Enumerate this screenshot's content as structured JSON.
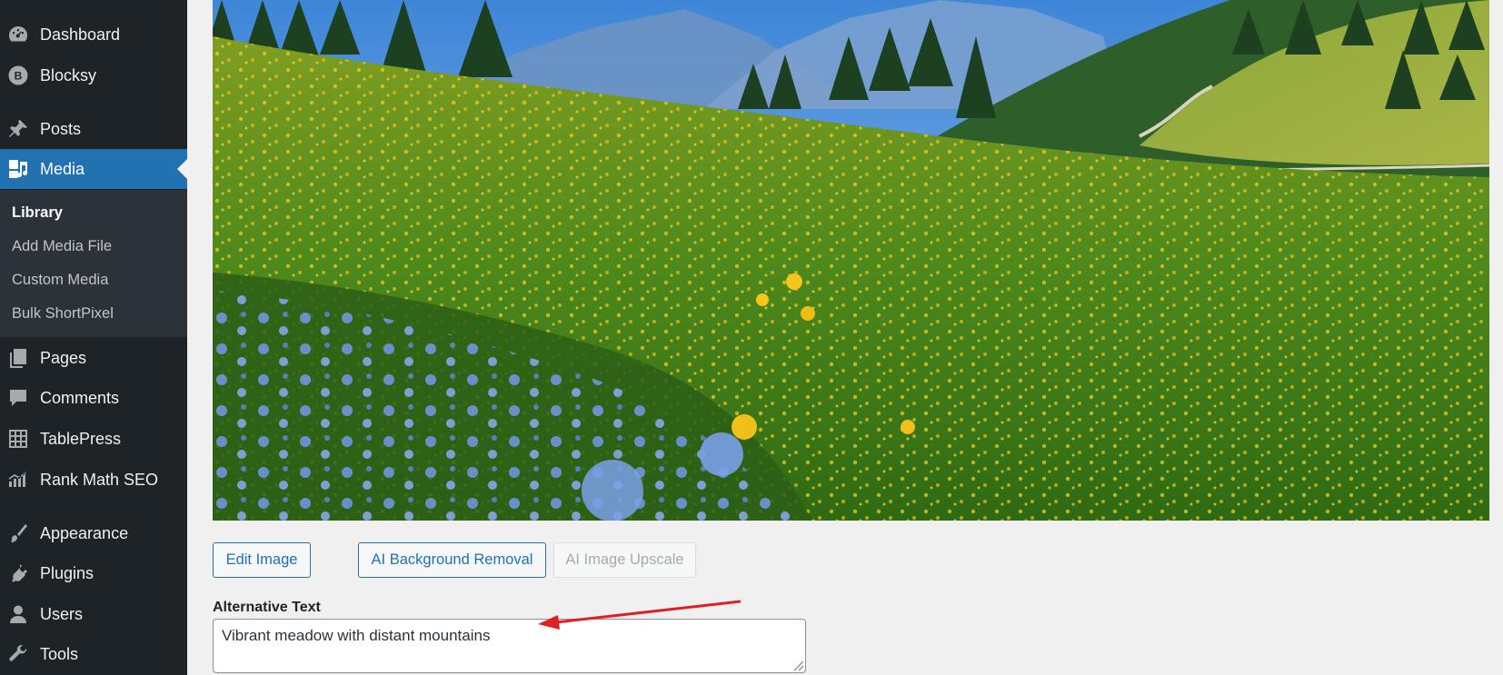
{
  "sidebar": {
    "items": [
      {
        "label": "Dashboard",
        "icon": "dashboard-icon"
      },
      {
        "label": "Blocksy",
        "icon": "blocksy-icon"
      },
      {
        "label": "Posts",
        "icon": "pin-icon"
      },
      {
        "label": "Media",
        "icon": "media-icon",
        "active": true
      },
      {
        "label": "Pages",
        "icon": "pages-icon"
      },
      {
        "label": "Comments",
        "icon": "comment-icon"
      },
      {
        "label": "TablePress",
        "icon": "table-icon"
      },
      {
        "label": "Rank Math SEO",
        "icon": "chart-icon"
      },
      {
        "label": "Appearance",
        "icon": "brush-icon"
      },
      {
        "label": "Plugins",
        "icon": "plug-icon"
      },
      {
        "label": "Users",
        "icon": "user-icon"
      },
      {
        "label": "Tools",
        "icon": "wrench-icon"
      }
    ],
    "submenu": [
      "Library",
      "Add Media File",
      "Custom Media",
      "Bulk ShortPixel"
    ]
  },
  "actions": {
    "edit_image": "Edit Image",
    "bg_removal": "AI Background Removal",
    "upscale": "AI Image Upscale"
  },
  "alt_text": {
    "label": "Alternative Text",
    "value": "Vibrant meadow with distant mountains"
  },
  "colors": {
    "sidebar_bg": "#1d2327",
    "submenu_bg": "#2c3338",
    "accent": "#2271b1",
    "arrow": "#e02020"
  }
}
